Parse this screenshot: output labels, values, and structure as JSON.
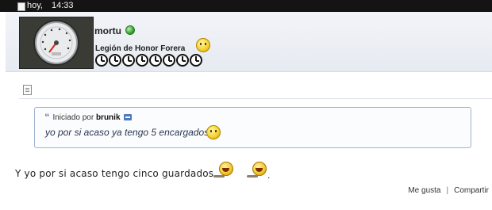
{
  "topbar": {
    "day": "hoy,",
    "time": "14:33"
  },
  "user": {
    "name": "mortu",
    "title": "Legión de Honor Forera",
    "online": true,
    "badge_count": 7
  },
  "quote": {
    "prefix": "Iniciado por",
    "author": "brunik",
    "text": "yo por si acaso ya tengo 5 encargados!"
  },
  "post": {
    "text": "Y yo por si acaso tengo cinco guardados",
    "trailing": "."
  },
  "actions": {
    "like_label": "Me gusta",
    "separator": "|",
    "share_label": "Compartir"
  },
  "icons": {
    "online_status": "online-dot-icon",
    "title_emote": "smiley-icon",
    "post_icon": "document-icon",
    "quote_goto": "goto-post-icon",
    "laugh": "laughing-smiley-icon"
  },
  "colors": {
    "topbar_bg": "#141414",
    "quote_border": "#9fb3d1",
    "online_green": "#3aa136"
  }
}
